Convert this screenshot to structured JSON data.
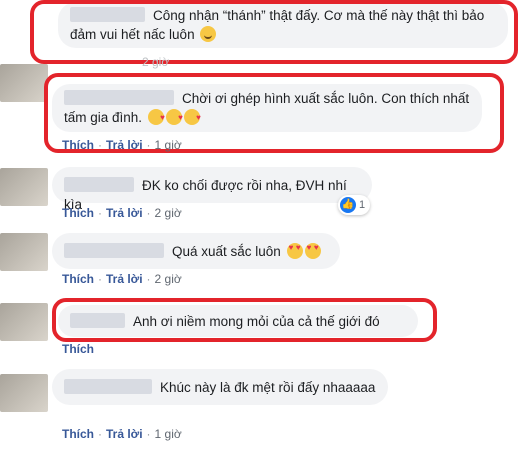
{
  "comments": [
    {
      "text_line1": "Công nhận “thánh” thật đấy. Cơ mà thế này thật thì bảo",
      "text_line2": "đảm vui hết nấc luôn",
      "time": "2 giờ"
    },
    {
      "text_line1": "Chời ơi ghép hình xuất sắc luôn. Con thích nhất",
      "text_line2": "tấm gia đình.",
      "time": "1 giờ"
    },
    {
      "text": "ĐK ko chối được rồi nha, ĐVH nhí kìa",
      "time": "2 giờ",
      "reactions": "1"
    },
    {
      "text": "Quá xuất sắc luôn",
      "time": "2 giờ"
    },
    {
      "text": "Anh ơi niềm mong mỏi của cả thế giới đó",
      "time": ""
    },
    {
      "text": "Khúc này là đk mệt rồi đấy nhaaaaa",
      "time": "1 giờ"
    }
  ],
  "actions": {
    "like": "Thích",
    "reply": "Trả lời",
    "sep": "·"
  },
  "colors": {
    "highlight": "#e3242b",
    "link": "#385898",
    "bubble": "#f2f3f5"
  }
}
